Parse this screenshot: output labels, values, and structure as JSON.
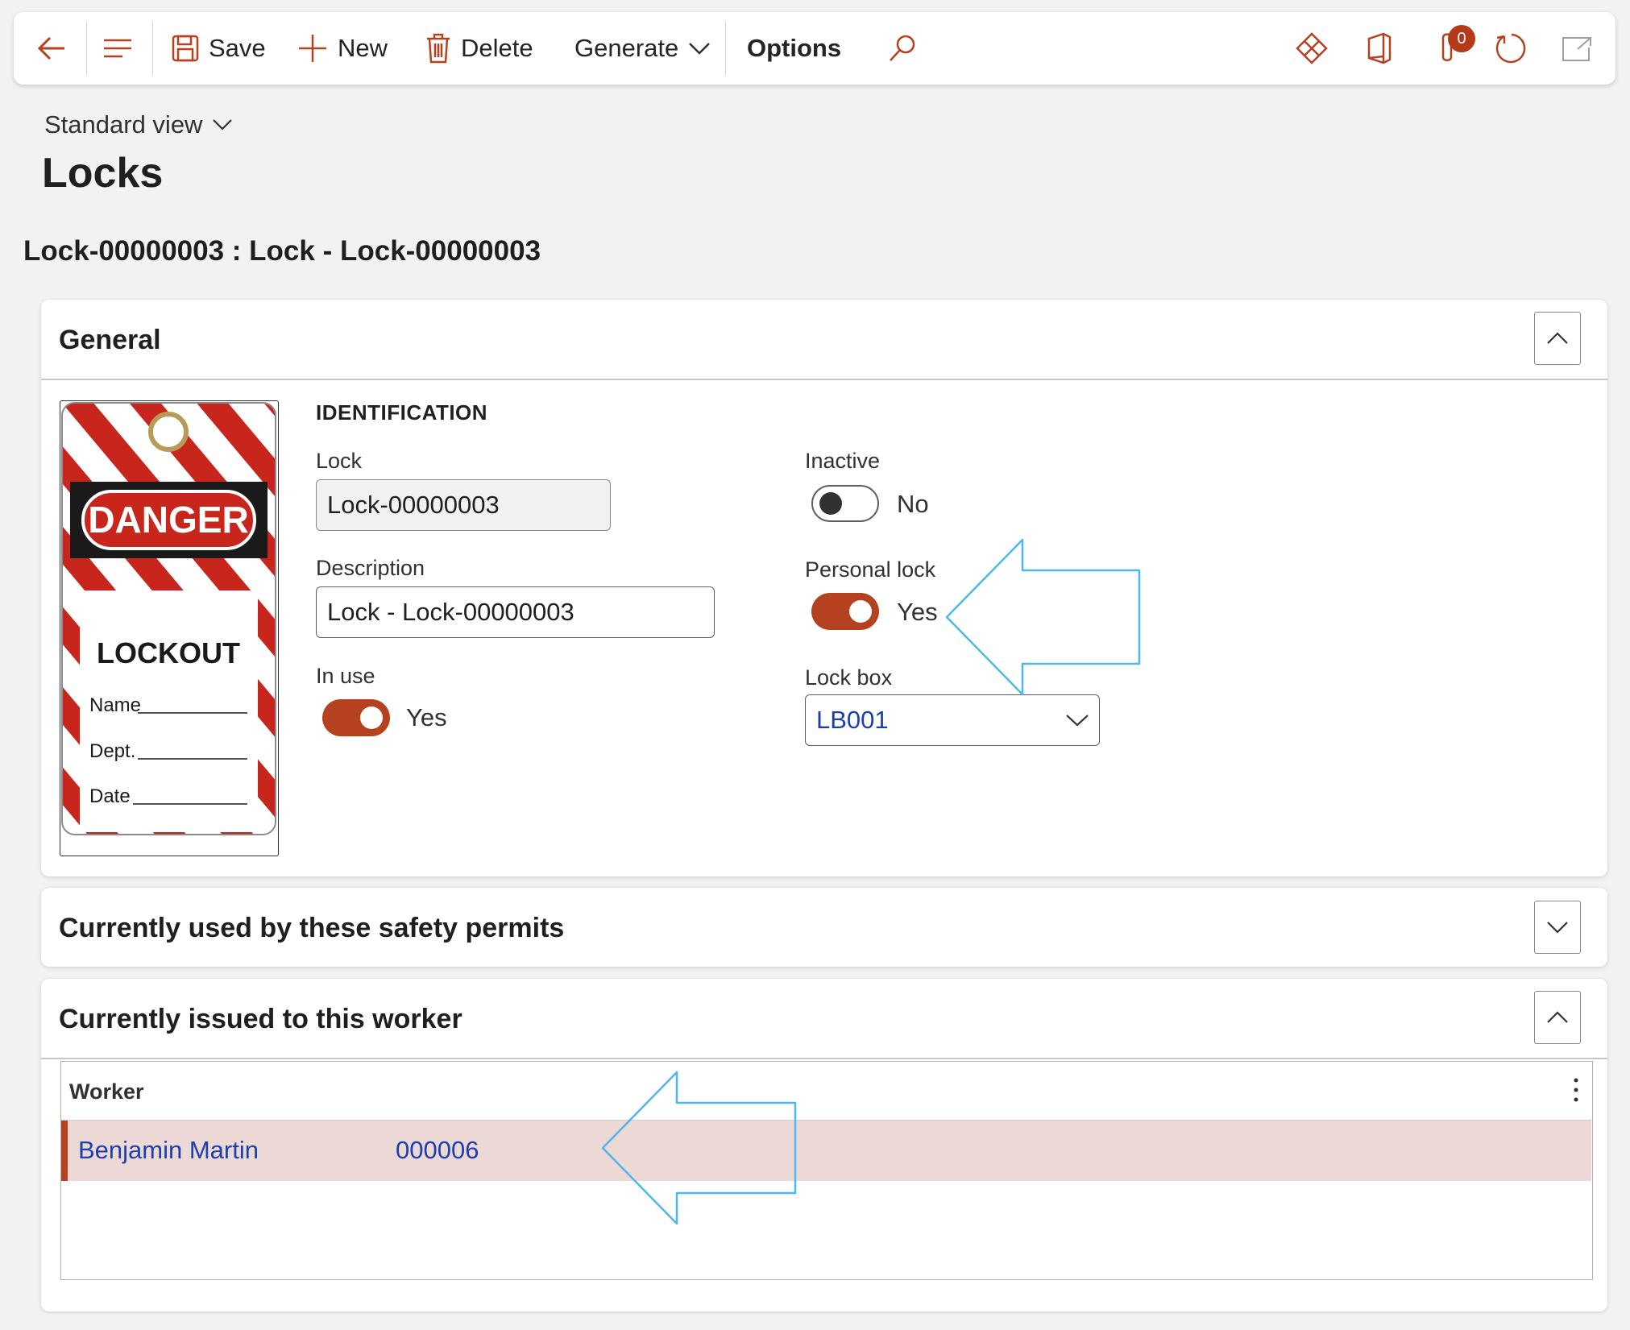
{
  "toolbar": {
    "save_label": "Save",
    "new_label": "New",
    "delete_label": "Delete",
    "generate_label": "Generate",
    "options_label": "Options",
    "attachments_count": "0"
  },
  "view": {
    "label": "Standard view"
  },
  "page": {
    "title": "Locks",
    "record_title": "Lock-00000003 : Lock - Lock-00000003"
  },
  "general": {
    "header": "General",
    "image_text": {
      "danger": "DANGER",
      "lockout": "LOCKOUT",
      "name": "Name",
      "dept": "Dept.",
      "date": "Date"
    },
    "section_title": "IDENTIFICATION",
    "lock_label": "Lock",
    "lock_value": "Lock-00000003",
    "description_label": "Description",
    "description_value": "Lock - Lock-00000003",
    "in_use_label": "In use",
    "in_use_value": "Yes",
    "inactive_label": "Inactive",
    "inactive_value": "No",
    "personal_lock_label": "Personal lock",
    "personal_lock_value": "Yes",
    "lock_box_label": "Lock box",
    "lock_box_value": "LB001"
  },
  "permits_section": {
    "header": "Currently used by these safety permits"
  },
  "worker_section": {
    "header": "Currently issued to this worker",
    "column_header": "Worker",
    "rows": [
      {
        "name": "Benjamin Martin",
        "id": "000006"
      }
    ]
  },
  "colors": {
    "accent": "#b5411f",
    "link": "#1c3fae",
    "annotation_arrow": "#4fb7ea",
    "selected_row": "#ecd9d5"
  }
}
